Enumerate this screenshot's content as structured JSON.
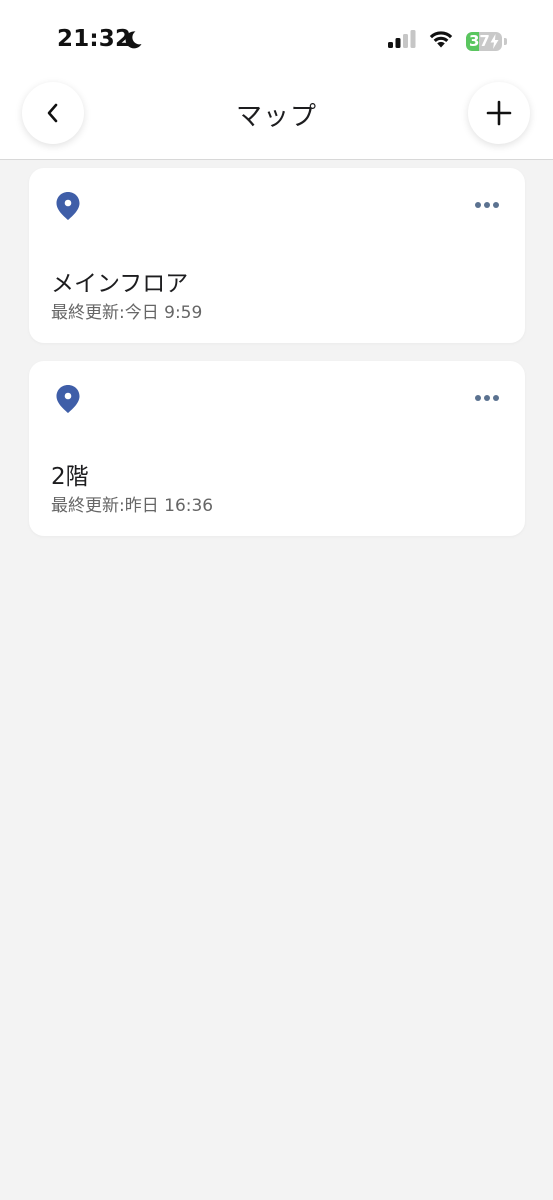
{
  "status_bar": {
    "time": "21:32",
    "battery_level": "37",
    "icons": [
      "moon-icon",
      "signal-icon",
      "wifi-icon",
      "battery-charging-icon"
    ]
  },
  "header": {
    "title": "マップ",
    "back_icon": "chevron-left-icon",
    "add_icon": "plus-icon"
  },
  "maps": [
    {
      "name": "メインフロア",
      "updated": "最終更新:今日 9:59",
      "icon": "location-pin-icon",
      "menu_icon": "more-horizontal-icon"
    },
    {
      "name": "2階",
      "updated": "最終更新:昨日 16:36",
      "icon": "location-pin-icon",
      "menu_icon": "more-horizontal-icon"
    }
  ],
  "colors": {
    "background": "#f3f3f3",
    "card": "#ffffff",
    "pin": "#3f5ea8",
    "more_dots": "#5b7290",
    "battery": "#5ac65f"
  }
}
